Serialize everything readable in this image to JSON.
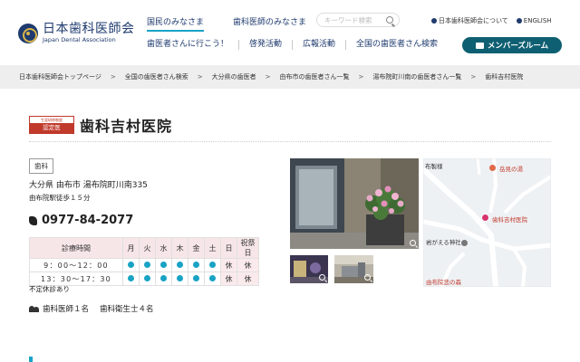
{
  "header": {
    "logo": {
      "title": "日本歯科医師会",
      "subtitle": "Japan Dental Association"
    },
    "tabs": [
      {
        "label": "国民のみなさま",
        "active": true
      },
      {
        "label": "歯科医師のみなさま",
        "active": false
      }
    ],
    "search": {
      "placeholder": "キーワード検索",
      "icon": "search-icon"
    },
    "util_links": [
      {
        "label": "日本歯科医師会について",
        "icon": "info-circle-icon"
      },
      {
        "label": "ENGLISH",
        "icon": "globe-icon"
      }
    ],
    "nav": [
      "歯医者さんに行こう！",
      "啓発活動",
      "広報活動",
      "全国の歯医者さん検索"
    ],
    "member_button": "メンバーズルーム"
  },
  "breadcrumb": [
    "日本歯科医師会トップページ",
    "全国の歯医者さん検索",
    "大分県の歯医者",
    "由布市の歯医者さん一覧",
    "湯布院町川南の歯医者さん一覧",
    "歯科吉村医院"
  ],
  "clinic": {
    "badge": {
      "top": "生涯研修制度",
      "bottom": "認定医"
    },
    "name": "歯科吉村医院",
    "category": "歯科",
    "address": "大分県 由布市 湯布院町川南335",
    "access": "由布院駅徒歩１５分",
    "phone": "0977-84-2077",
    "hours": {
      "header": [
        "診療時間",
        "月",
        "火",
        "水",
        "木",
        "金",
        "土",
        "日",
        "祝祭日"
      ],
      "rows": [
        {
          "time": "9：00～12：00",
          "days": [
            "open",
            "open",
            "open",
            "open",
            "open",
            "open",
            "休",
            "休"
          ]
        },
        {
          "time": "13：30～17：30",
          "days": [
            "open",
            "open",
            "open",
            "open",
            "open",
            "open",
            "休",
            "休"
          ]
        }
      ],
      "open_color": "#18a3c4"
    },
    "irregular": "不定休診あり",
    "staff": {
      "dentists": "歯科医師１名",
      "hygienists": "歯科衛生士４名"
    }
  },
  "map": {
    "labels": {
      "top_left": "布製様",
      "poi1": "岳見の湯",
      "clinic": "歯科吉村医院",
      "shrine": "岩がえる神社",
      "bottom": "由布院悲の森"
    }
  },
  "colors": {
    "brand": "#1e3a6e",
    "accent": "#1aa3c8",
    "member_button": "#0f5f72",
    "badge_red": "#c0392b"
  }
}
